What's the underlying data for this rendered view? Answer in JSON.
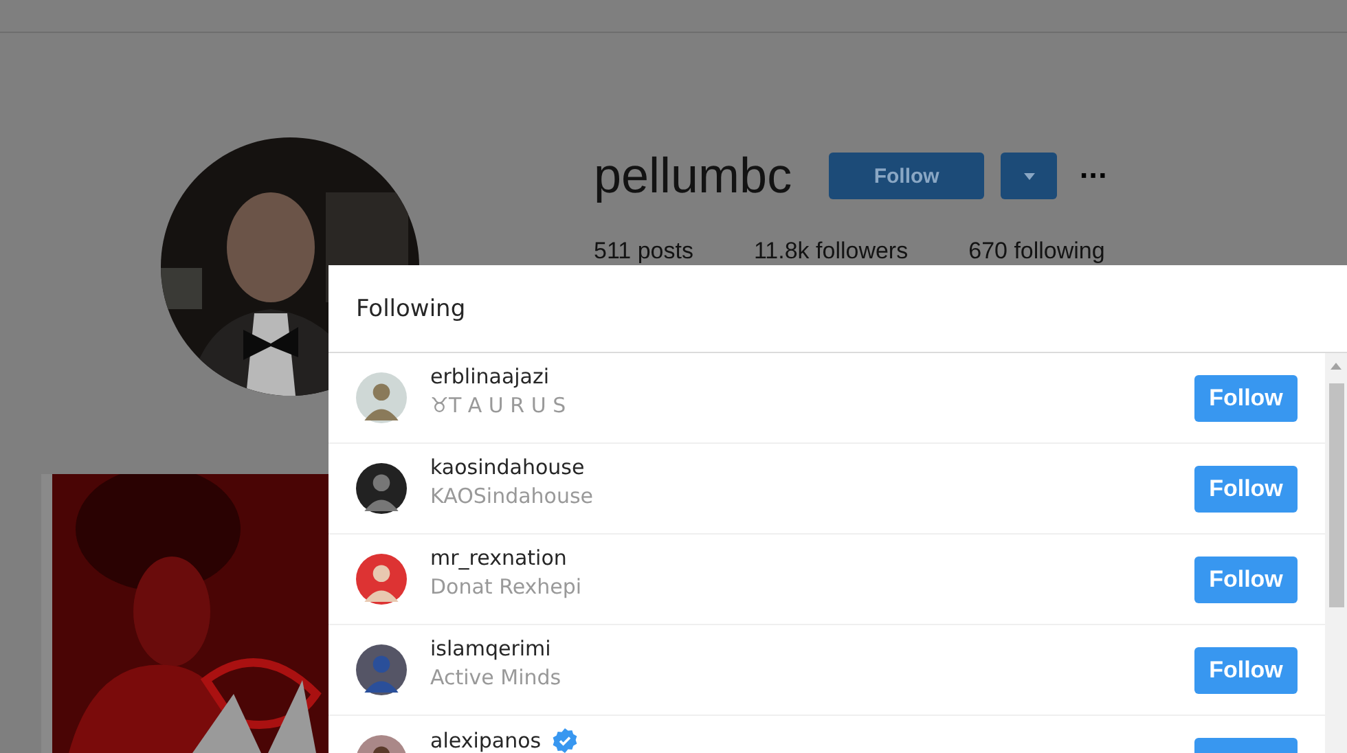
{
  "profile": {
    "username": "pellumbc",
    "follow_button": "Follow",
    "more": "···",
    "stats": [
      "511 posts",
      "11.8k followers",
      "670 following"
    ]
  },
  "modal": {
    "title": "Following",
    "users": [
      {
        "username": "erblinaajazi",
        "subtitle": "♉T A U R U S",
        "verified": false,
        "button": "Follow"
      },
      {
        "username": "kaosindahouse",
        "subtitle": "KAOSindahouse",
        "verified": false,
        "button": "Follow"
      },
      {
        "username": "mr_rexnation",
        "subtitle": "Donat Rexhepi",
        "verified": false,
        "button": "Follow"
      },
      {
        "username": "islamqerimi",
        "subtitle": "Active Minds",
        "verified": false,
        "button": "Follow"
      },
      {
        "username": "alexipanos",
        "verified": true
      }
    ]
  }
}
